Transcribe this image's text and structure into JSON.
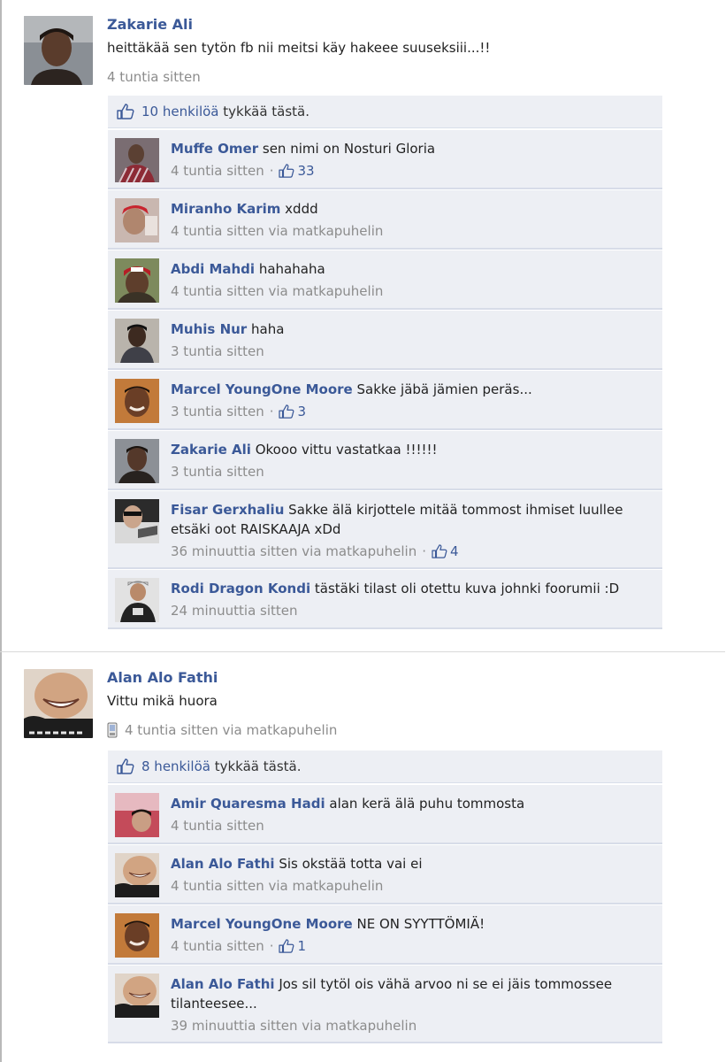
{
  "colors": {
    "link": "#3b5998",
    "meta": "#8c8c8c",
    "comment_bg": "#edeff4"
  },
  "posts": [
    {
      "author": "Zakarie Ali",
      "text": "heittäkää sen tytön fb nii meitsi käy hakeee suuseksiii...!!",
      "time": "4 tuntia sitten",
      "likes": {
        "link": "10 henkilöä",
        "rest": " tykkää tästä."
      },
      "comments": [
        {
          "author": "Muffe Omer",
          "text": "sen nimi on Nosturi Gloria",
          "time": "4 tuntia sitten",
          "sep": "·",
          "likes": "33"
        },
        {
          "author": "Miranho Karim",
          "text": "xddd",
          "time": "4 tuntia sitten via matkapuhelin"
        },
        {
          "author": "Abdi Mahdi",
          "text": "hahahaha",
          "time": "4 tuntia sitten via matkapuhelin"
        },
        {
          "author": "Muhis Nur",
          "text": "haha",
          "time": "3 tuntia sitten"
        },
        {
          "author": "Marcel YoungOne Moore",
          "text": "Sakke jäbä jämien peräs...",
          "time": "3 tuntia sitten",
          "sep": "·",
          "likes": "3"
        },
        {
          "author": "Zakarie Ali",
          "text": "Okooo vittu vastatkaa !!!!!!",
          "time": "3 tuntia sitten"
        },
        {
          "author": "Fisar Gerxhaliu",
          "text": "Sakke älä kirjottele mitää tommost ihmiset luullee etsäki oot RAISKAAJA xDd",
          "time": "36 minuuttia sitten via matkapuhelin",
          "sep": "·",
          "likes": "4"
        },
        {
          "author": "Rodi Dragon Kondi",
          "text": "tästäki tilast oli otettu kuva johnki foorumii :D",
          "time": "24 minuuttia sitten"
        }
      ]
    },
    {
      "author": "Alan Alo Fathi",
      "text": "Vittu mikä huora",
      "time": "4 tuntia sitten via matkapuhelin",
      "likes": {
        "link": "8 henkilöä",
        "rest": " tykkää tästä."
      },
      "comments": [
        {
          "author": "Amir Quaresma Hadi",
          "text": "alan kerä älä puhu tommosta",
          "time": "4 tuntia sitten"
        },
        {
          "author": "Alan Alo Fathi",
          "text": "Sis okstää totta vai ei",
          "time": "4 tuntia sitten via matkapuhelin"
        },
        {
          "author": "Marcel YoungOne Moore",
          "text": "NE ON SYYTTÖMIÄ!",
          "time": "4 tuntia sitten",
          "sep": "·",
          "likes": "1"
        },
        {
          "author": "Alan Alo Fathi",
          "text": "Jos sil tytöl ois vähä arvoo ni se ei jäis tommossee tilanteesee...",
          "time": "39 minuuttia sitten via matkapuhelin"
        }
      ]
    }
  ]
}
